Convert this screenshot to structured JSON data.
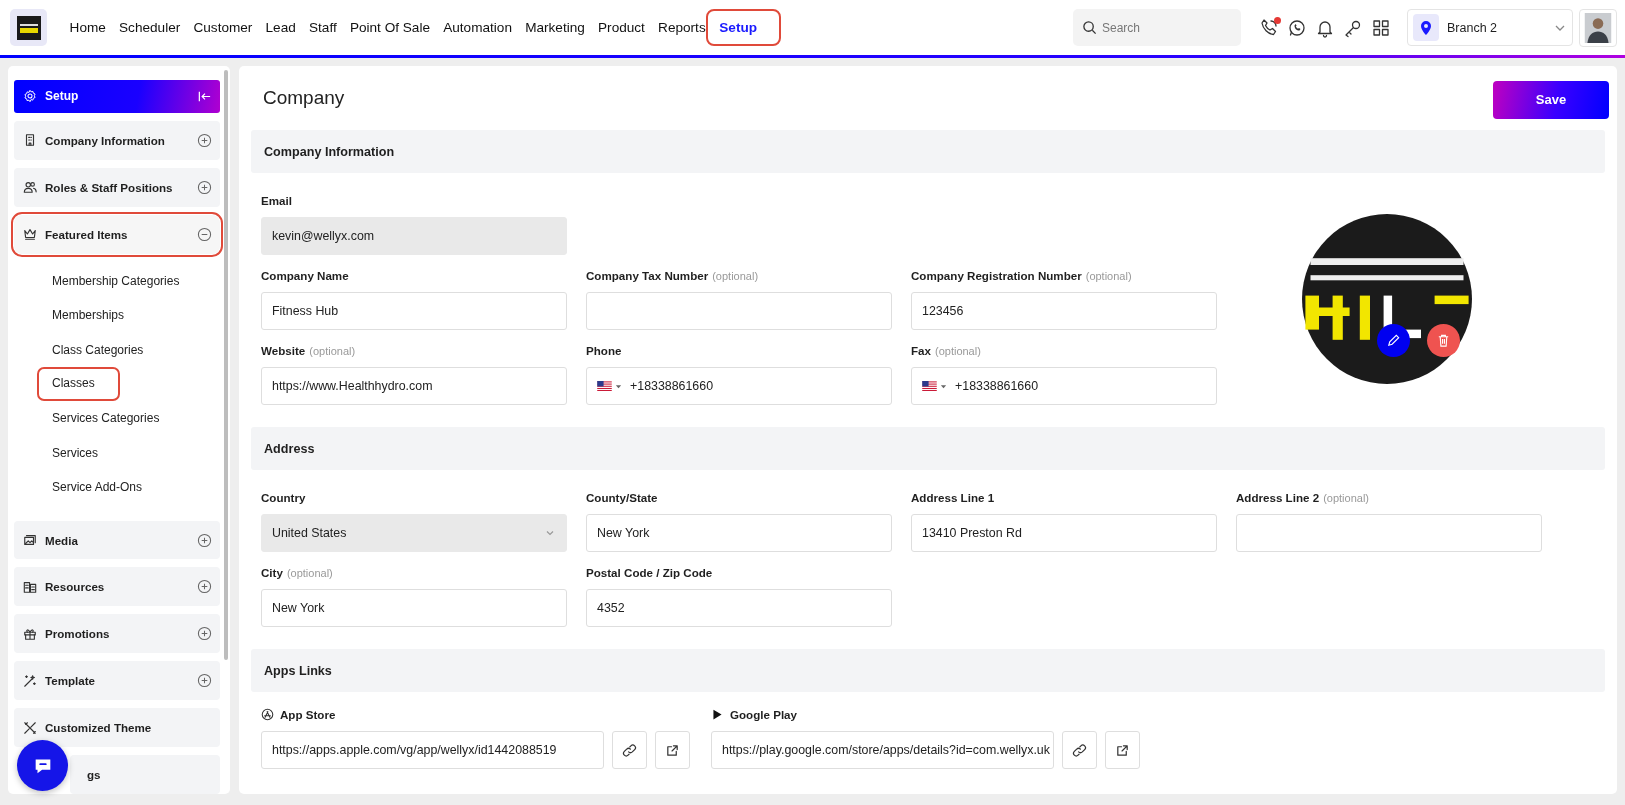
{
  "header": {
    "nav": [
      {
        "label": "Home",
        "selected": false,
        "highlighted": false
      },
      {
        "label": "Scheduler",
        "selected": false,
        "highlighted": false
      },
      {
        "label": "Customer",
        "selected": false,
        "highlighted": false
      },
      {
        "label": "Lead",
        "selected": false,
        "highlighted": false
      },
      {
        "label": "Staff",
        "selected": false,
        "highlighted": false
      },
      {
        "label": "Point Of Sale",
        "selected": false,
        "highlighted": false
      },
      {
        "label": "Automation",
        "selected": false,
        "highlighted": false
      },
      {
        "label": "Marketing",
        "selected": false,
        "highlighted": false
      },
      {
        "label": "Product",
        "selected": false,
        "highlighted": false
      },
      {
        "label": "Reports",
        "selected": false,
        "highlighted": false
      },
      {
        "label": "Setup",
        "selected": true,
        "highlighted": true
      }
    ],
    "search": {
      "placeholder": "Search"
    },
    "missed_call": true,
    "branch": "Branch 2"
  },
  "sidebar": {
    "title": "Setup",
    "items": [
      {
        "label": "Company Information",
        "kind": "group",
        "expanded": false,
        "highlighted": false
      },
      {
        "label": "Roles & Staff Positions",
        "kind": "group",
        "expanded": false,
        "highlighted": false
      },
      {
        "label": "Featured Items",
        "kind": "group",
        "expanded": true,
        "highlighted": true,
        "children": [
          {
            "label": "Membership Categories",
            "highlighted": false
          },
          {
            "label": "Memberships",
            "highlighted": false
          },
          {
            "label": "Class Categories",
            "highlighted": false
          },
          {
            "label": "Classes",
            "highlighted": true
          },
          {
            "label": "Services Categories",
            "highlighted": false
          },
          {
            "label": "Services",
            "highlighted": false
          },
          {
            "label": "Service Add-Ons",
            "highlighted": false
          }
        ]
      },
      {
        "label": "Media",
        "kind": "group",
        "expanded": false,
        "highlighted": false
      },
      {
        "label": "Resources",
        "kind": "group",
        "expanded": false,
        "highlighted": false
      },
      {
        "label": "Promotions",
        "kind": "group",
        "expanded": false,
        "highlighted": false
      },
      {
        "label": "Template",
        "kind": "group",
        "expanded": false,
        "highlighted": false
      },
      {
        "label": "Customized Theme",
        "kind": "link",
        "highlighted": false
      },
      {
        "label": "gs",
        "kind": "link",
        "highlighted": false
      }
    ]
  },
  "page": {
    "title": "Company",
    "save": "Save"
  },
  "sections": [
    {
      "title": "Company Information",
      "kind": "company",
      "fields": [
        {
          "label": "Email",
          "kind": "readonly",
          "value": "kevin@wellyx.com"
        },
        {
          "label": "Company Name",
          "kind": "text",
          "value": "Fitness Hub"
        },
        {
          "label": "Company Tax Number",
          "hint": "(optional)",
          "kind": "text"
        },
        {
          "label": "Company Registration Number",
          "hint": "(optional)",
          "kind": "text",
          "value": "123456"
        },
        {
          "label": "Website",
          "hint": "(optional)",
          "kind": "text",
          "value": "https://www.Healthhydro.com"
        },
        {
          "label": "Phone",
          "kind": "phone",
          "value": "+18338861660"
        },
        {
          "label": "Fax",
          "hint": "(optional)",
          "kind": "phone",
          "value": "+18338861660"
        }
      ]
    },
    {
      "title": "Address",
      "kind": "grid",
      "fields": [
        {
          "label": "Country",
          "kind": "select",
          "value": "United States"
        },
        {
          "label": "County/State",
          "kind": "text",
          "value": "New York"
        },
        {
          "label": "Address Line 1",
          "kind": "text",
          "value": "13410 Preston Rd"
        },
        {
          "label": "Address Line 2",
          "hint": "(optional)",
          "kind": "text"
        },
        {
          "label": "City",
          "hint": "(optional)",
          "kind": "text",
          "value": "New York"
        },
        {
          "label": "Postal Code / Zip Code",
          "kind": "text",
          "value": "4352"
        }
      ]
    },
    {
      "title": "Apps Links",
      "kind": "apps",
      "fields": [
        {
          "label": "App Store",
          "kind": "link",
          "value": "https://apps.apple.com/vg/app/wellyx/id1442088519"
        },
        {
          "label": "Google Play",
          "kind": "link",
          "value": "https://play.google.com/store/apps/details?id=com.wellyx.uk"
        }
      ]
    }
  ]
}
